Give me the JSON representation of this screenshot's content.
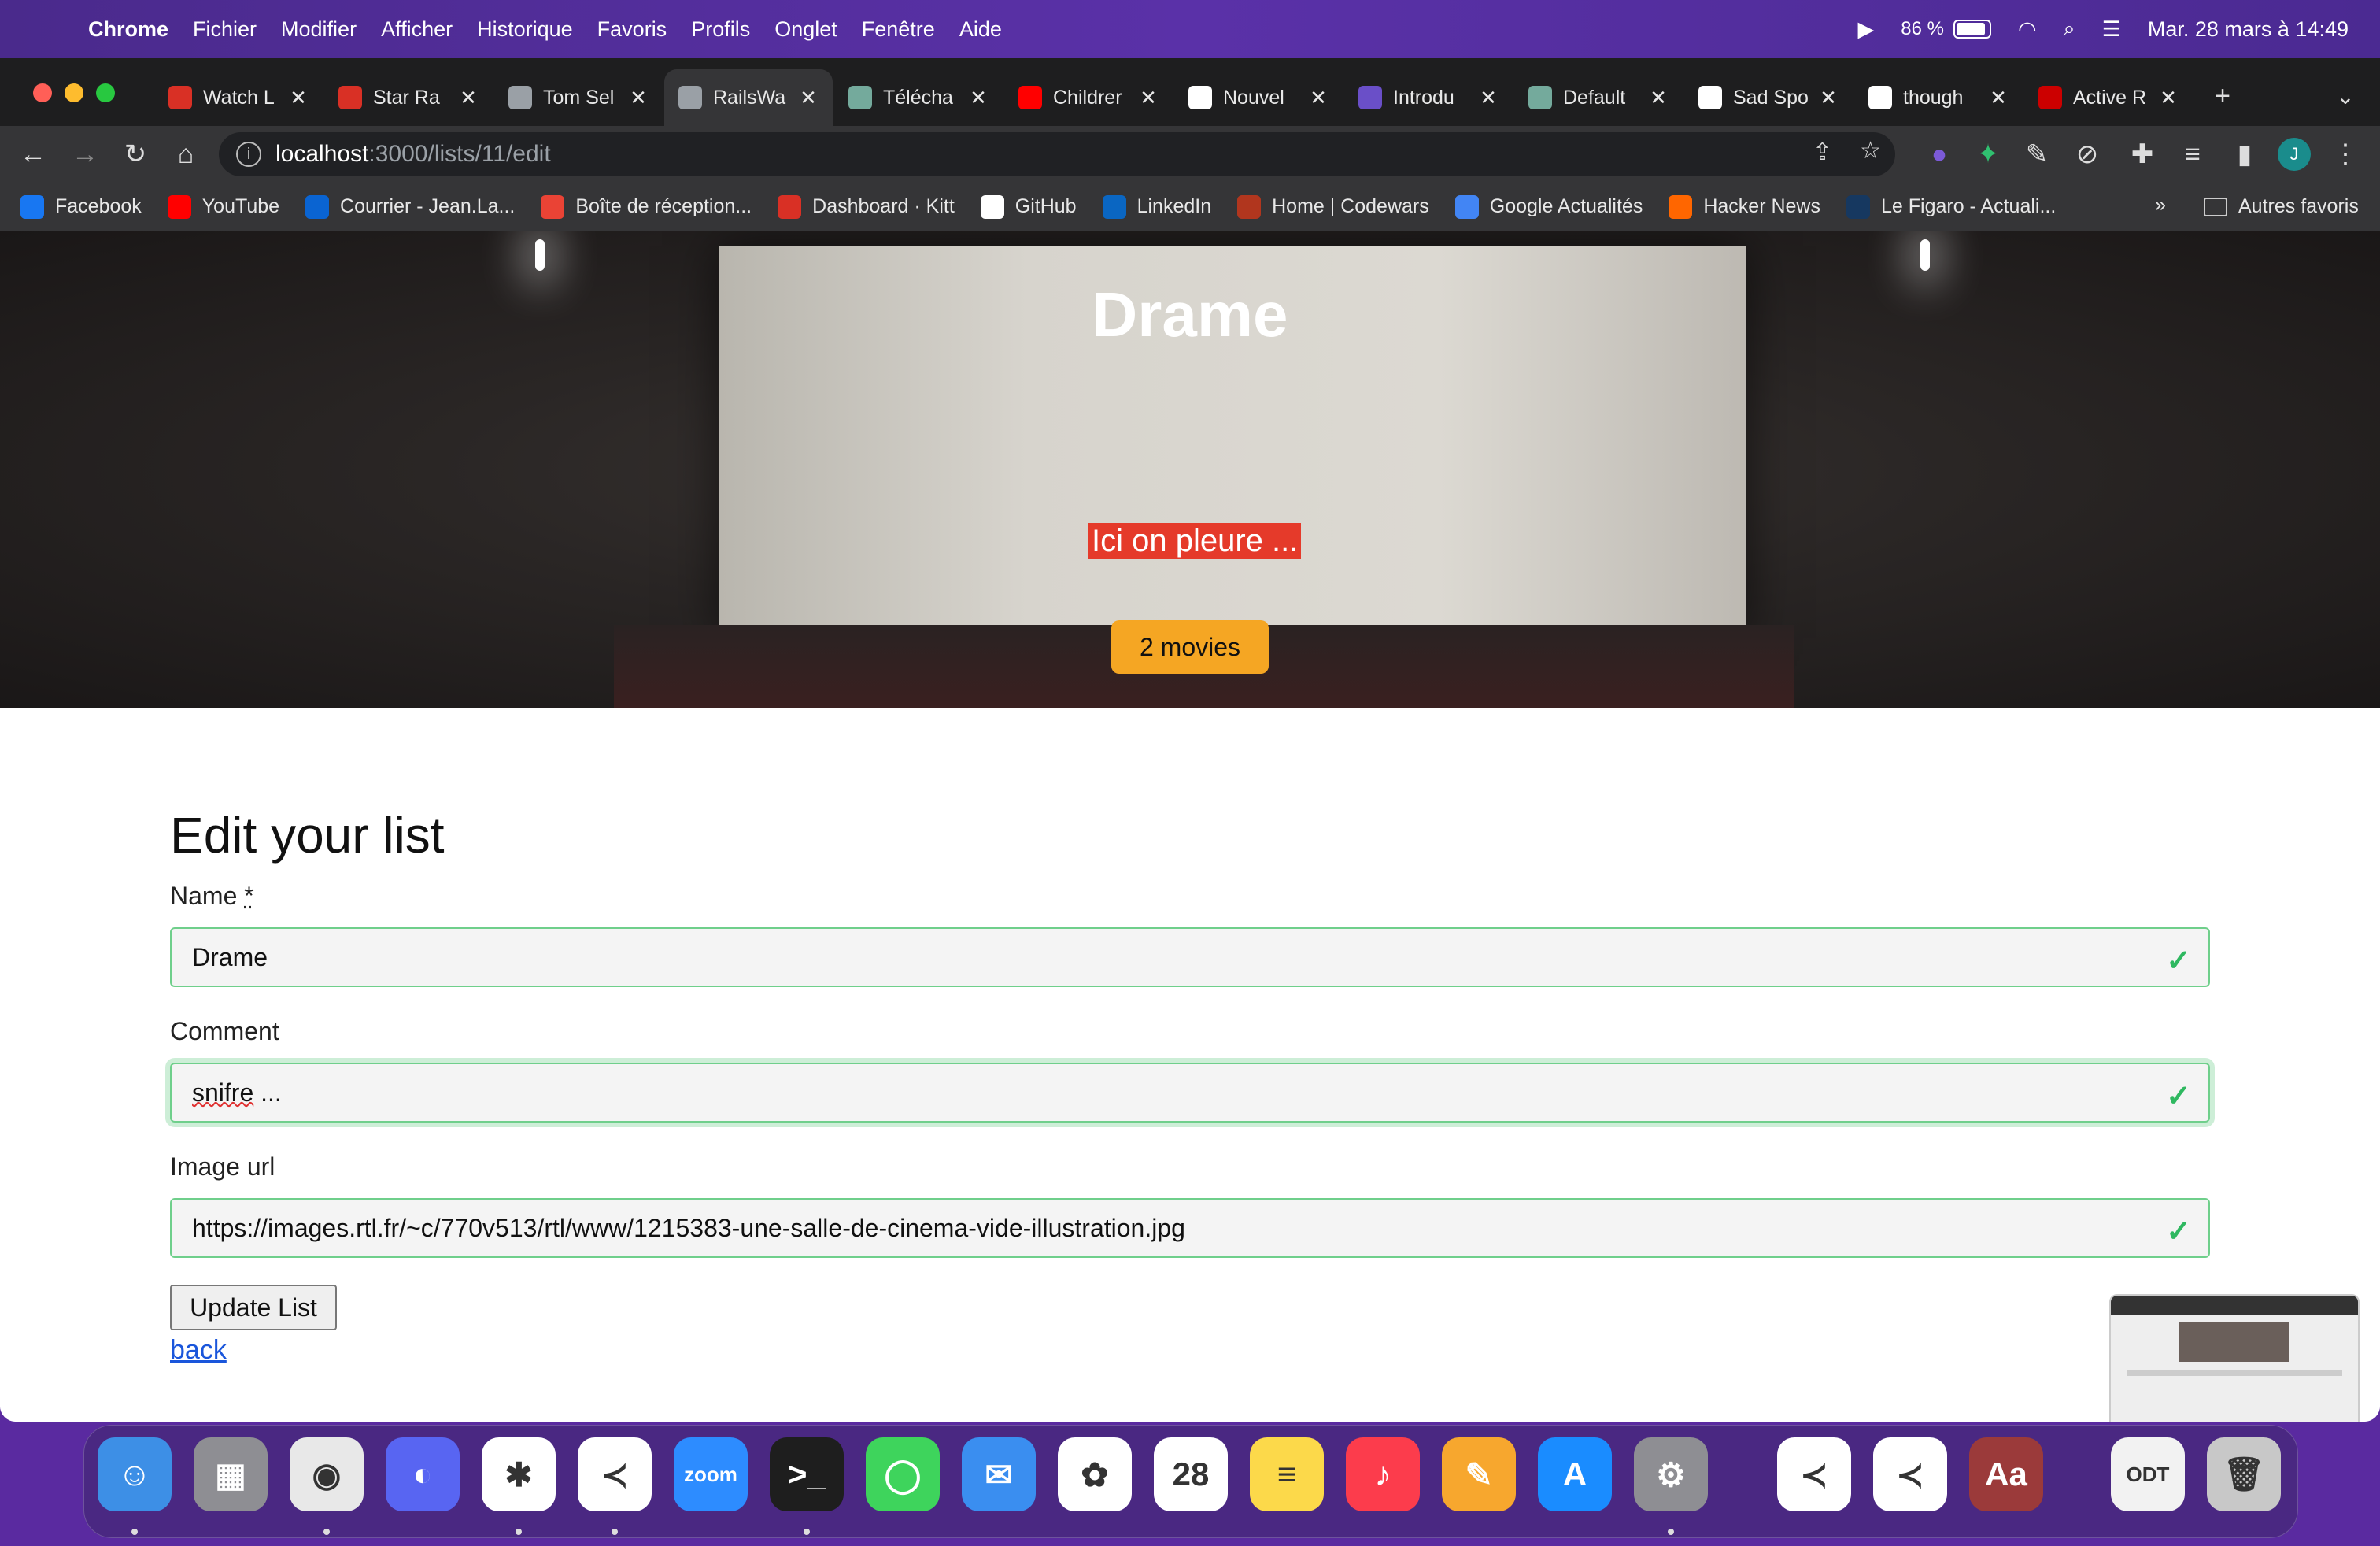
{
  "menubar": {
    "app": "Chrome",
    "items": [
      "Fichier",
      "Modifier",
      "Afficher",
      "Historique",
      "Favoris",
      "Profils",
      "Onglet",
      "Fenêtre",
      "Aide"
    ],
    "battery": "86 %",
    "datetime": "Mar. 28 mars à 14:49"
  },
  "tabs": [
    {
      "title": "Watch L",
      "color": "#d93025",
      "active": false
    },
    {
      "title": "Star Ra",
      "color": "#d93025",
      "active": false
    },
    {
      "title": "Tom Sel",
      "color": "#9aa0a6",
      "active": false
    },
    {
      "title": "RailsWa",
      "color": "#9aa0a6",
      "active": true
    },
    {
      "title": "Télécha",
      "color": "#74aa9c",
      "active": false
    },
    {
      "title": "Childrer",
      "color": "#ff0000",
      "active": false
    },
    {
      "title": "Nouvel",
      "color": "#ffffff",
      "active": false
    },
    {
      "title": "Introdu",
      "color": "#6a4fc8",
      "active": false
    },
    {
      "title": "Default",
      "color": "#74aa9c",
      "active": false
    },
    {
      "title": "Sad Spo",
      "color": "#ffffff",
      "active": false
    },
    {
      "title": "though",
      "color": "#ffffff",
      "active": false
    },
    {
      "title": "Active R",
      "color": "#cc0000",
      "active": false
    }
  ],
  "address": {
    "host": "localhost",
    "path": ":3000/lists/11/edit"
  },
  "bookmarks": [
    {
      "label": "Facebook",
      "color": "#1877f2"
    },
    {
      "label": "YouTube",
      "color": "#ff0000"
    },
    {
      "label": "Courrier - Jean.La...",
      "color": "#0a64d2"
    },
    {
      "label": "Boîte de réception...",
      "color": "#ea4335"
    },
    {
      "label": "Dashboard · Kitt",
      "color": "#d93025"
    },
    {
      "label": "GitHub",
      "color": "#ffffff"
    },
    {
      "label": "LinkedIn",
      "color": "#0a66c2"
    },
    {
      "label": "Home | Codewars",
      "color": "#b1361e"
    },
    {
      "label": "Google Actualités",
      "color": "#4285f4"
    },
    {
      "label": "Hacker News",
      "color": "#ff6600"
    },
    {
      "label": "Le Figaro - Actuali...",
      "color": "#163860"
    }
  ],
  "bookmarks_more": "»",
  "bookmarks_other": "Autres favoris",
  "hero": {
    "title": "Drame",
    "comment": "Ici on pleure ...",
    "badge": "2 movies"
  },
  "form": {
    "title": "Edit your list",
    "name_label": "Name",
    "name_required": "*",
    "name_value": "Drame",
    "comment_label": "Comment",
    "comment_value_word": "snifre",
    "comment_value_rest": " ...",
    "image_label": "Image url",
    "image_value": "https://images.rtl.fr/~c/770v513/rtl/www/1215383-une-salle-de-cinema-vide-illustration.jpg",
    "submit": "Update List",
    "back": "back"
  },
  "dock": {
    "apps": [
      {
        "name": "Finder",
        "color": "#3d8fe6",
        "glyph": "☺"
      },
      {
        "name": "Launchpad",
        "color": "#8e8e93",
        "glyph": "▦"
      },
      {
        "name": "Chrome",
        "color": "#e8e8e8",
        "glyph": "◉"
      },
      {
        "name": "Discord",
        "color": "#5865f2",
        "glyph": "◐"
      },
      {
        "name": "Slack",
        "color": "#ffffff",
        "glyph": "✱"
      },
      {
        "name": "VS Code",
        "color": "#ffffff",
        "glyph": "≺"
      },
      {
        "name": "Zoom",
        "color": "#2d8cff",
        "glyph": "zoom"
      },
      {
        "name": "Terminal",
        "color": "#1e1e1e",
        "glyph": ">_"
      },
      {
        "name": "Messages",
        "color": "#3ed45c",
        "glyph": "◯"
      },
      {
        "name": "Mail",
        "color": "#3a8ef0",
        "glyph": "✉"
      },
      {
        "name": "Photos",
        "color": "#ffffff",
        "glyph": "✿"
      },
      {
        "name": "Calendar",
        "color": "#ffffff",
        "glyph": "28"
      },
      {
        "name": "Notes",
        "color": "#fcd94a",
        "glyph": "≡"
      },
      {
        "name": "Music",
        "color": "#fc3c4c",
        "glyph": "♪"
      },
      {
        "name": "Pages",
        "color": "#f7a72e",
        "glyph": "✎"
      },
      {
        "name": "App Store",
        "color": "#1a8cff",
        "glyph": "A"
      },
      {
        "name": "System Settings",
        "color": "#8e8e93",
        "glyph": "⚙"
      },
      {
        "name": "VS Code 2",
        "color": "#ffffff",
        "glyph": "≺"
      },
      {
        "name": "VS Code 3",
        "color": "#ffffff",
        "glyph": "≺"
      },
      {
        "name": "Dictionary",
        "color": "#9b3a3a",
        "glyph": "Aa"
      },
      {
        "name": "ODT document",
        "color": "#f2f2f2",
        "glyph": "ODT"
      },
      {
        "name": "Trash",
        "color": "#c8c8c8",
        "glyph": "🗑"
      }
    ]
  }
}
